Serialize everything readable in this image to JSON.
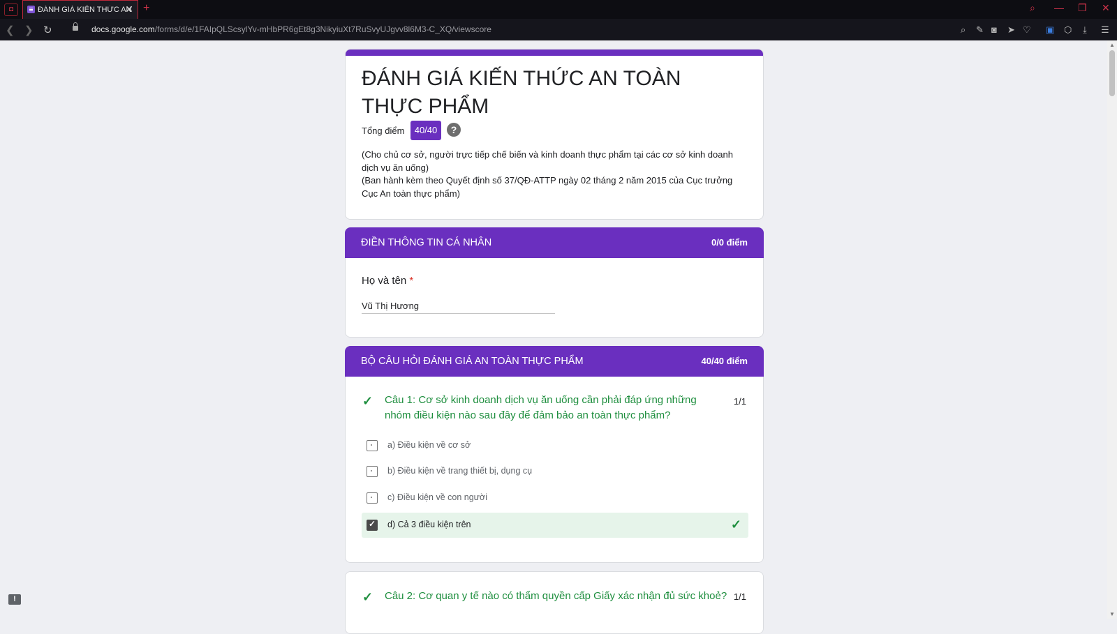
{
  "browser": {
    "tab_title": "ĐÁNH GIÁ KIẾN THỨC AN",
    "url_domain": "docs.google.com",
    "url_path": "/forms/d/e/1FAIpQLScsylYv-mHbPR6gEt8g3NikyiuXt7RuSvyUJgvv8l6M3-C_XQ/viewscore",
    "new_tab_symbol": "+",
    "close_symbol": "✕"
  },
  "form": {
    "title": "ĐÁNH GIÁ KIẾN THỨC AN TOÀN THỰC PHẨM",
    "score_label": "Tổng điểm",
    "score_value": "40/40",
    "help_symbol": "?",
    "description_line1": "(Cho chủ cơ sở, người trực tiếp chế biến và kinh doanh thực phẩm tại các cơ sở kinh doanh dịch vụ ăn uống)",
    "description_line2": "(Ban hành kèm theo Quyết định số 37/QĐ-ATTP ngày   02  tháng 2  năm 2015 của Cục trưởng Cục An toàn thực phẩm)"
  },
  "section1": {
    "title": "ĐIỀN THÔNG TIN CÁ NHÂN",
    "score": "0/0 điểm",
    "question_label": "Họ và tên",
    "required_mark": "*",
    "answer": "Vũ Thị Hương"
  },
  "section2": {
    "title": "BỘ CÂU HỎI ĐÁNH GIÁ AN TOÀN THỰC PHẨM",
    "score": "40/40 điểm",
    "questions": [
      {
        "text": "Câu 1: Cơ sở kinh doanh dịch vụ ăn uống cần phải đáp ứng những nhóm điều kiện nào sau đây để đảm bảo an toàn thực phẩm?",
        "points": "1/1",
        "options": [
          {
            "text": "a) Điều kiện về cơ sở",
            "selected": false
          },
          {
            "text": "b) Điều kiện về trang thiết bị, dụng cụ",
            "selected": false
          },
          {
            "text": "c) Điều kiện về con người",
            "selected": false
          },
          {
            "text": "d) Cả 3 điều kiện trên",
            "selected": true,
            "correct": true
          }
        ]
      },
      {
        "text": "Câu 2: Cơ quan y tế nào có thẩm quyền cấp Giấy xác nhận đủ sức khoẻ?",
        "points": "1/1"
      }
    ]
  },
  "colors": {
    "accent": "#6a2fbf",
    "correct_green": "#1e8e3e",
    "correct_bg": "#e6f4ea"
  },
  "icons": {
    "check": "check-icon",
    "help": "help-icon",
    "feedback": "feedback-icon"
  },
  "feedback_symbol": "!"
}
